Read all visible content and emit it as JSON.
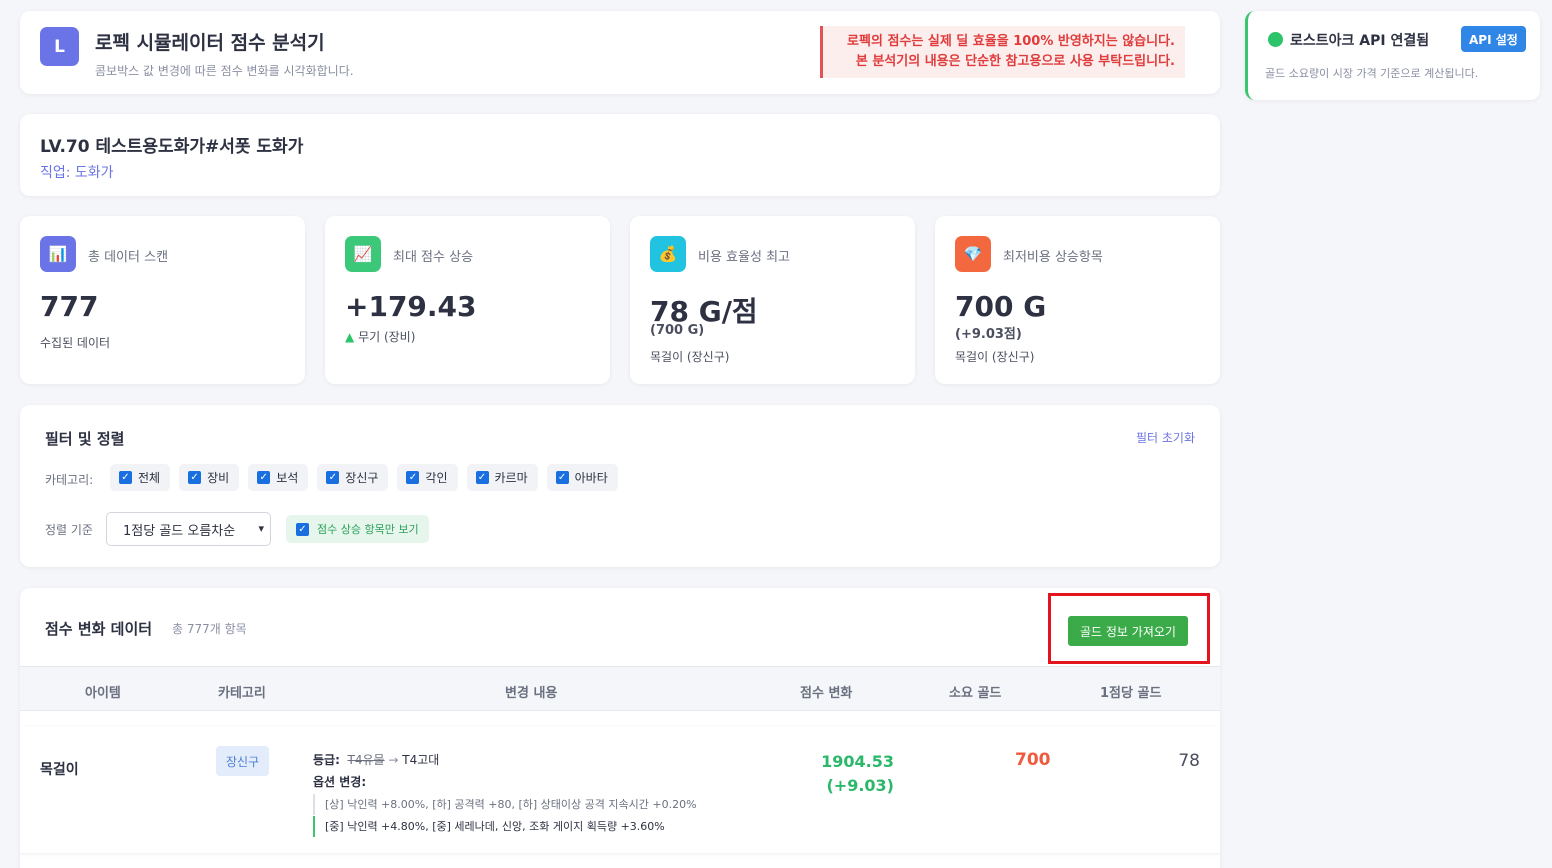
{
  "header": {
    "logo_letter": "L",
    "title": "로펙 시뮬레이터 점수 분석기",
    "subtitle": "콤보박스 값 변경에 따른 점수 변화를 시각화합니다.",
    "warning_line1": "로펙의 점수는 실제 딜 효율을 100% 반영하지는 않습니다.",
    "warning_line2": "본 분석기의 내용은 단순한 참고용으로 사용 부탁드립니다."
  },
  "api": {
    "status": "로스트아크 API 연결됨",
    "button": "API 설정",
    "note": "골드 소요량이 시장 가격 기준으로 계산됩니다."
  },
  "character": {
    "name": "LV.70 테스트용도화가#서폿 도화가",
    "class_line": "직업: 도화가"
  },
  "stats": [
    {
      "icon": "bar-chart-icon",
      "glyph": "📊",
      "label": "총 데이터 스캔",
      "value": "777",
      "extra": "",
      "desc": "수집된 데이터",
      "color": "#6b74e6"
    },
    {
      "icon": "trend-up-icon",
      "glyph": "📈",
      "label": "최대 점수 상승",
      "value": "+179.43",
      "extra": "",
      "desc": "무기 (장비)",
      "color": "#3cc879"
    },
    {
      "icon": "money-bag-icon",
      "glyph": "💰",
      "label": "비용 효율성 최고",
      "value": "78 G/점",
      "extra": "(700 G)",
      "desc": "목걸이 (장신구)",
      "color": "#22c3e0"
    },
    {
      "icon": "gem-icon",
      "glyph": "💎",
      "label": "최저비용 상승항목",
      "value": "700 G",
      "extra": "(+9.03점)",
      "desc": "목걸이 (장신구)",
      "color": "#f4683f"
    }
  ],
  "filter": {
    "title": "필터 및 정렬",
    "reset": "필터 초기화",
    "category_label": "카테고리:",
    "categories": [
      "전체",
      "장비",
      "보석",
      "장신구",
      "각인",
      "카르마",
      "아바타"
    ],
    "sort_label": "정렬 기준",
    "sort_value": "1점당 골드 오름차순",
    "score_only": "점수 상승 항목만 보기"
  },
  "table": {
    "title": "점수 변화 데이터",
    "count": "총 777개 항목",
    "gold_button": "골드 정보 가져오기",
    "columns": [
      "아이템",
      "카테고리",
      "변경 내용",
      "점수 변화",
      "소요 골드",
      "1점당 골드"
    ],
    "rows": [
      {
        "item": "목걸이",
        "category": "장신구",
        "grade_label": "등급:",
        "grade_from": "T4유물",
        "arrow": "→",
        "grade_to": "T4고대",
        "options_label": "옵션 변경:",
        "option_old": "[상] 낙인력 +8.00%, [하] 공격력 +80, [하] 상태이상 공격 지속시간 +0.20%",
        "option_new": "[중] 낙인력 +4.80%, [중] 세레나데, 신앙, 조화 게이지 획득량 +3.60%",
        "score": "1904.53",
        "score_delta": "(+9.03)",
        "gold": "700",
        "per_point": "78"
      }
    ]
  }
}
